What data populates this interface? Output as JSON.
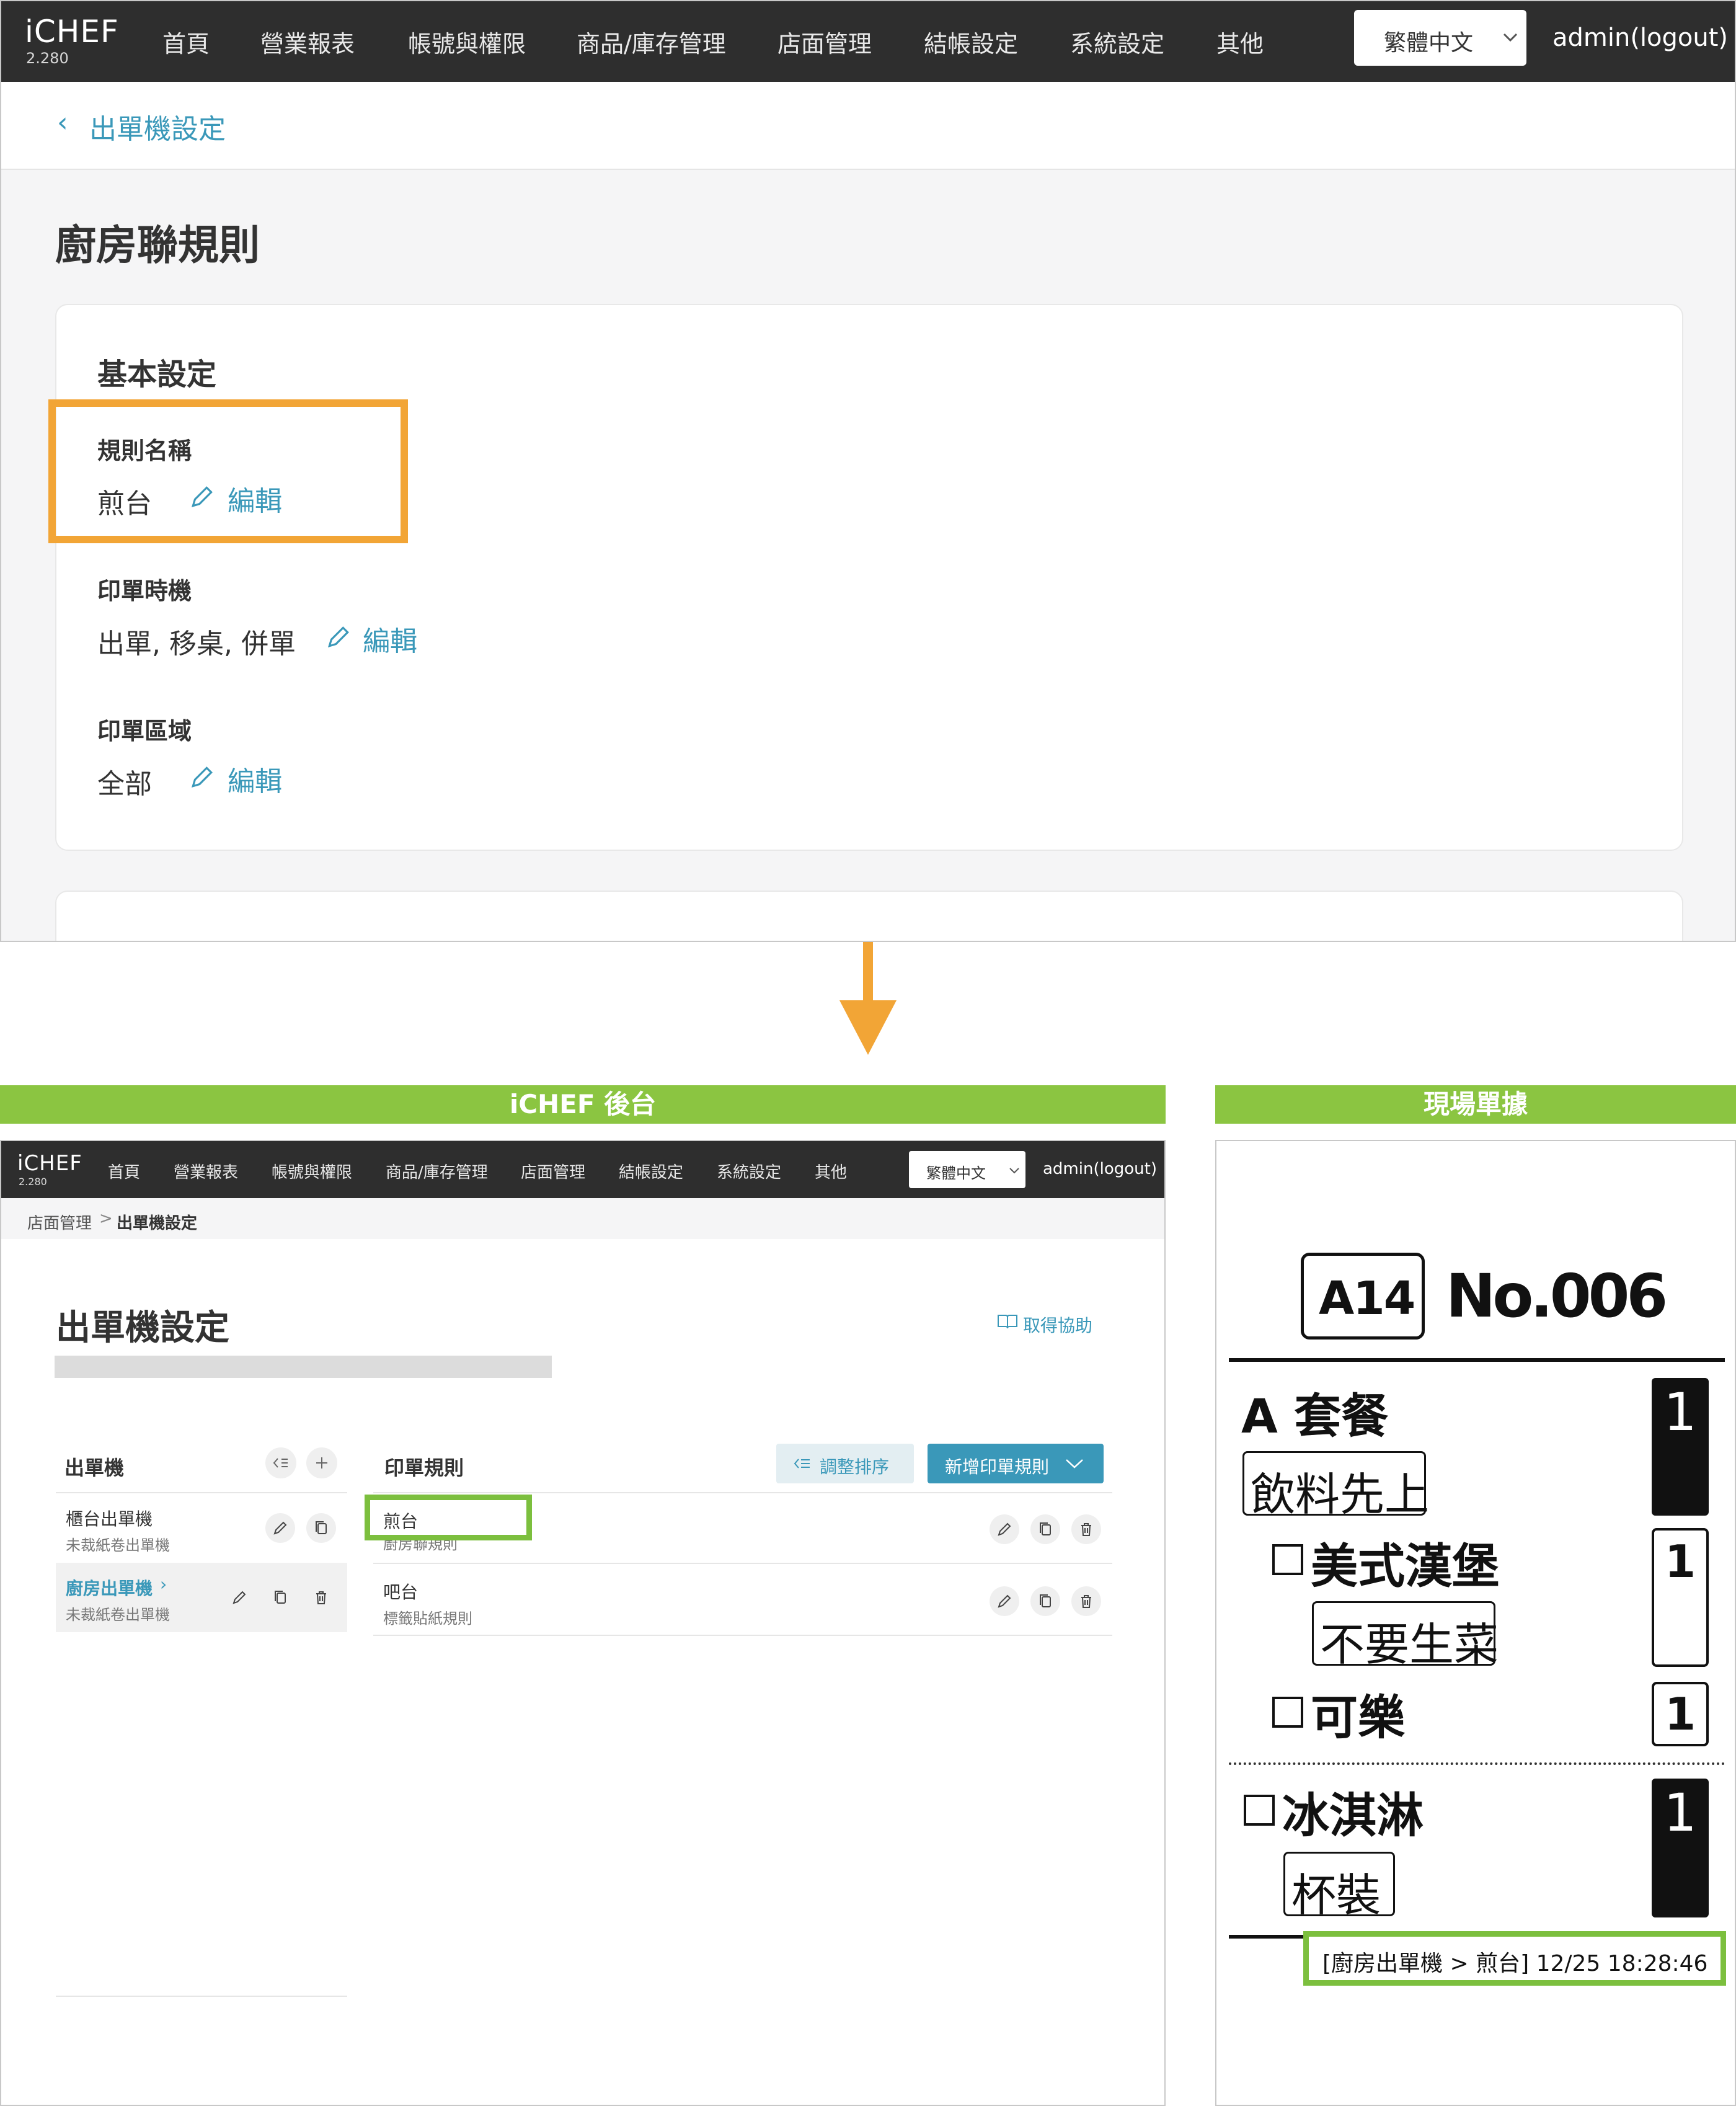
{
  "top": {
    "logo": "iCHEF",
    "version": "2.280",
    "nav": [
      "首頁",
      "營業報表",
      "帳號與權限",
      "商品/庫存管理",
      "店面管理",
      "結帳設定",
      "系統設定",
      "其他"
    ],
    "language": "繁體中文",
    "admin": "admin(logout)",
    "back_label": "出單機設定",
    "page_title": "廚房聯規則",
    "section_title": "基本設定",
    "fields": [
      {
        "label": "規則名稱",
        "value": "煎台",
        "edit": "編輯"
      },
      {
        "label": "印單時機",
        "value": "出單, 移桌, 併單",
        "edit": "編輯"
      },
      {
        "label": "印單區域",
        "value": "全部",
        "edit": "編輯"
      }
    ],
    "highlight_color": "#f2a536"
  },
  "headers": {
    "backend": "iCHEF 後台",
    "receipt": "現場單據",
    "color": "#8bc541"
  },
  "backend": {
    "logo": "iCHEF",
    "version": "2.280",
    "nav": [
      "首頁",
      "營業報表",
      "帳號與權限",
      "商品/庫存管理",
      "店面管理",
      "結帳設定",
      "系統設定",
      "其他"
    ],
    "language": "繁體中文",
    "admin": "admin(logout)",
    "breadcrumb_parent": "店面管理",
    "breadcrumb_sep": ">",
    "breadcrumb_current": "出單機設定",
    "page_title": "出單機設定",
    "help": "取得協助",
    "printers_header": "出單機",
    "rules_header": "印單規則",
    "sort_button": "調整排序",
    "add_rule_button": "新增印單規則",
    "printers": [
      {
        "name": "櫃台出單機",
        "sub": "未裁紙卷出單機",
        "selected": false
      },
      {
        "name": "廚房出單機",
        "sub": "未裁紙卷出單機",
        "selected": true
      }
    ],
    "rules": [
      {
        "name": "煎台",
        "sub": "廚房聯規則"
      },
      {
        "name": "吧台",
        "sub": "標籤貼紙規則"
      }
    ],
    "accent": "#3a98b9"
  },
  "receipt": {
    "table": "A14",
    "number": "No.006",
    "items": [
      {
        "name": "A 套餐",
        "note": "飲料先上",
        "qty": "1"
      },
      {
        "name": "美式漢堡",
        "note": "不要生菜",
        "qty": "1"
      },
      {
        "name": "可樂",
        "qty": "1"
      },
      {
        "name": "冰淇淋",
        "note": "杯裝",
        "qty": "1"
      }
    ],
    "footer": "[廚房出單機 > 煎台] 12/25 18:28:46"
  }
}
